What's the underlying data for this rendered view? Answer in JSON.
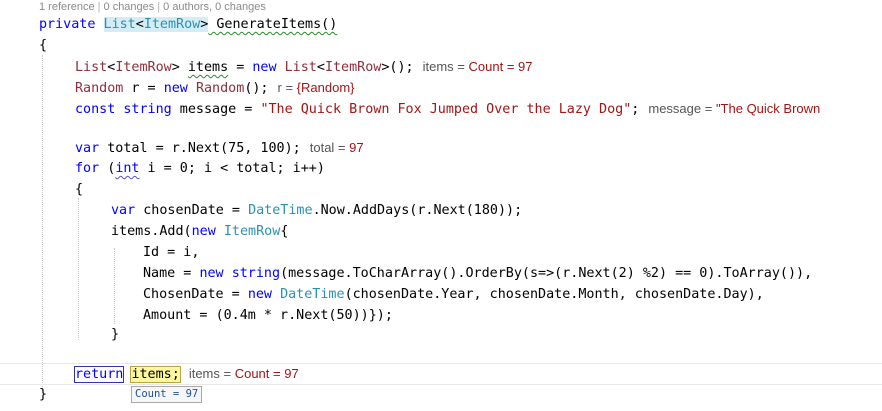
{
  "codelens": {
    "references": "1 reference",
    "changes": "0 changes",
    "authors": "0 authors, 0 changes"
  },
  "code": {
    "sig_private": "private",
    "sig_list": "List",
    "sig_lt": "<",
    "sig_itemrow": "ItemRow",
    "sig_gt": ">",
    "sig_rest": " GenerateItems()",
    "open_brace": "{",
    "l1_list": "List",
    "l1_lt": "<",
    "l1_itemrow": "ItemRow",
    "l1_gt": ">",
    "l1_space": " ",
    "l1_items": "items",
    "l1_eq": " = ",
    "l1_new": "new",
    "l1_sp2": " ",
    "l1_list2": "List",
    "l1_lt2": "<",
    "l1_itemrow2": "ItemRow",
    "l1_end": ">();",
    "l2_random": "Random",
    "l2_mid": " r = ",
    "l2_new": "new",
    "l2_sp": " ",
    "l2_random2": "Random",
    "l2_end": "();",
    "l3_const": "const",
    "l3_sp": " ",
    "l3_string": "string",
    "l3_mid": " message = ",
    "l3_str": "\"The Quick Brown Fox Jumped Over the Lazy Dog\"",
    "l3_end": ";",
    "l4_var": "var",
    "l4_rest": " total = r.Next(75, 100);",
    "l5_for": "for",
    "l5_a": " (",
    "l5_int": "int",
    "l5_rest": " i = 0; i < total; i++)",
    "l6_brace": "{",
    "l7_var": "var",
    "l7_mid": " chosenDate = ",
    "l7_datetime": "DateTime",
    "l7_rest": ".Now.AddDays(r.Next(180));",
    "l8_a": "items.Add(",
    "l8_new": "new",
    "l8_sp": " ",
    "l8_itemrow": "ItemRow",
    "l8_end": "{",
    "l9": "Id = i,",
    "l10_a": "Name = ",
    "l10_new": "new",
    "l10_sp": " ",
    "l10_string": "string",
    "l10_b": "(message.ToCharArray().OrderBy(s=>",
    "l10_c": "(r.Next(2) %2)",
    "l10_d": " == 0).ToArray()),",
    "l11_a": "ChosenDate = ",
    "l11_new": "new",
    "l11_sp": " ",
    "l11_datetime": "DateTime",
    "l11_rest": "(chosenDate.Year, chosenDate.Month, chosenDate.Day),",
    "l12_a": "Amount = ",
    "l12_b": "(0.4m * r.Next(50))",
    "l12_c": "});",
    "l13_brace": "}",
    "l14_return": "return",
    "l14_sp": " ",
    "l14_items": "items;",
    "close_brace": "}"
  },
  "hints": {
    "items_name": "items",
    "items_eq": " = ",
    "items_val": "Count = 97",
    "r_name": "r",
    "r_eq": " = ",
    "r_val": "{Random}",
    "message_name": "message",
    "message_eq": " = ",
    "message_val": "\"The Quick Brown",
    "total_name": "total",
    "total_eq": " = ",
    "total_val": "97",
    "return_items_name": "items",
    "return_items_eq": " = ",
    "return_items_val": "Count = 97"
  },
  "tooltip": {
    "text": "Count = 97"
  },
  "colors": {
    "keyword": "#0000ff",
    "type": "#2b91af",
    "string": "#a31515",
    "hint_value": "#a31515",
    "highlight_yellow": "#fff6a0"
  }
}
